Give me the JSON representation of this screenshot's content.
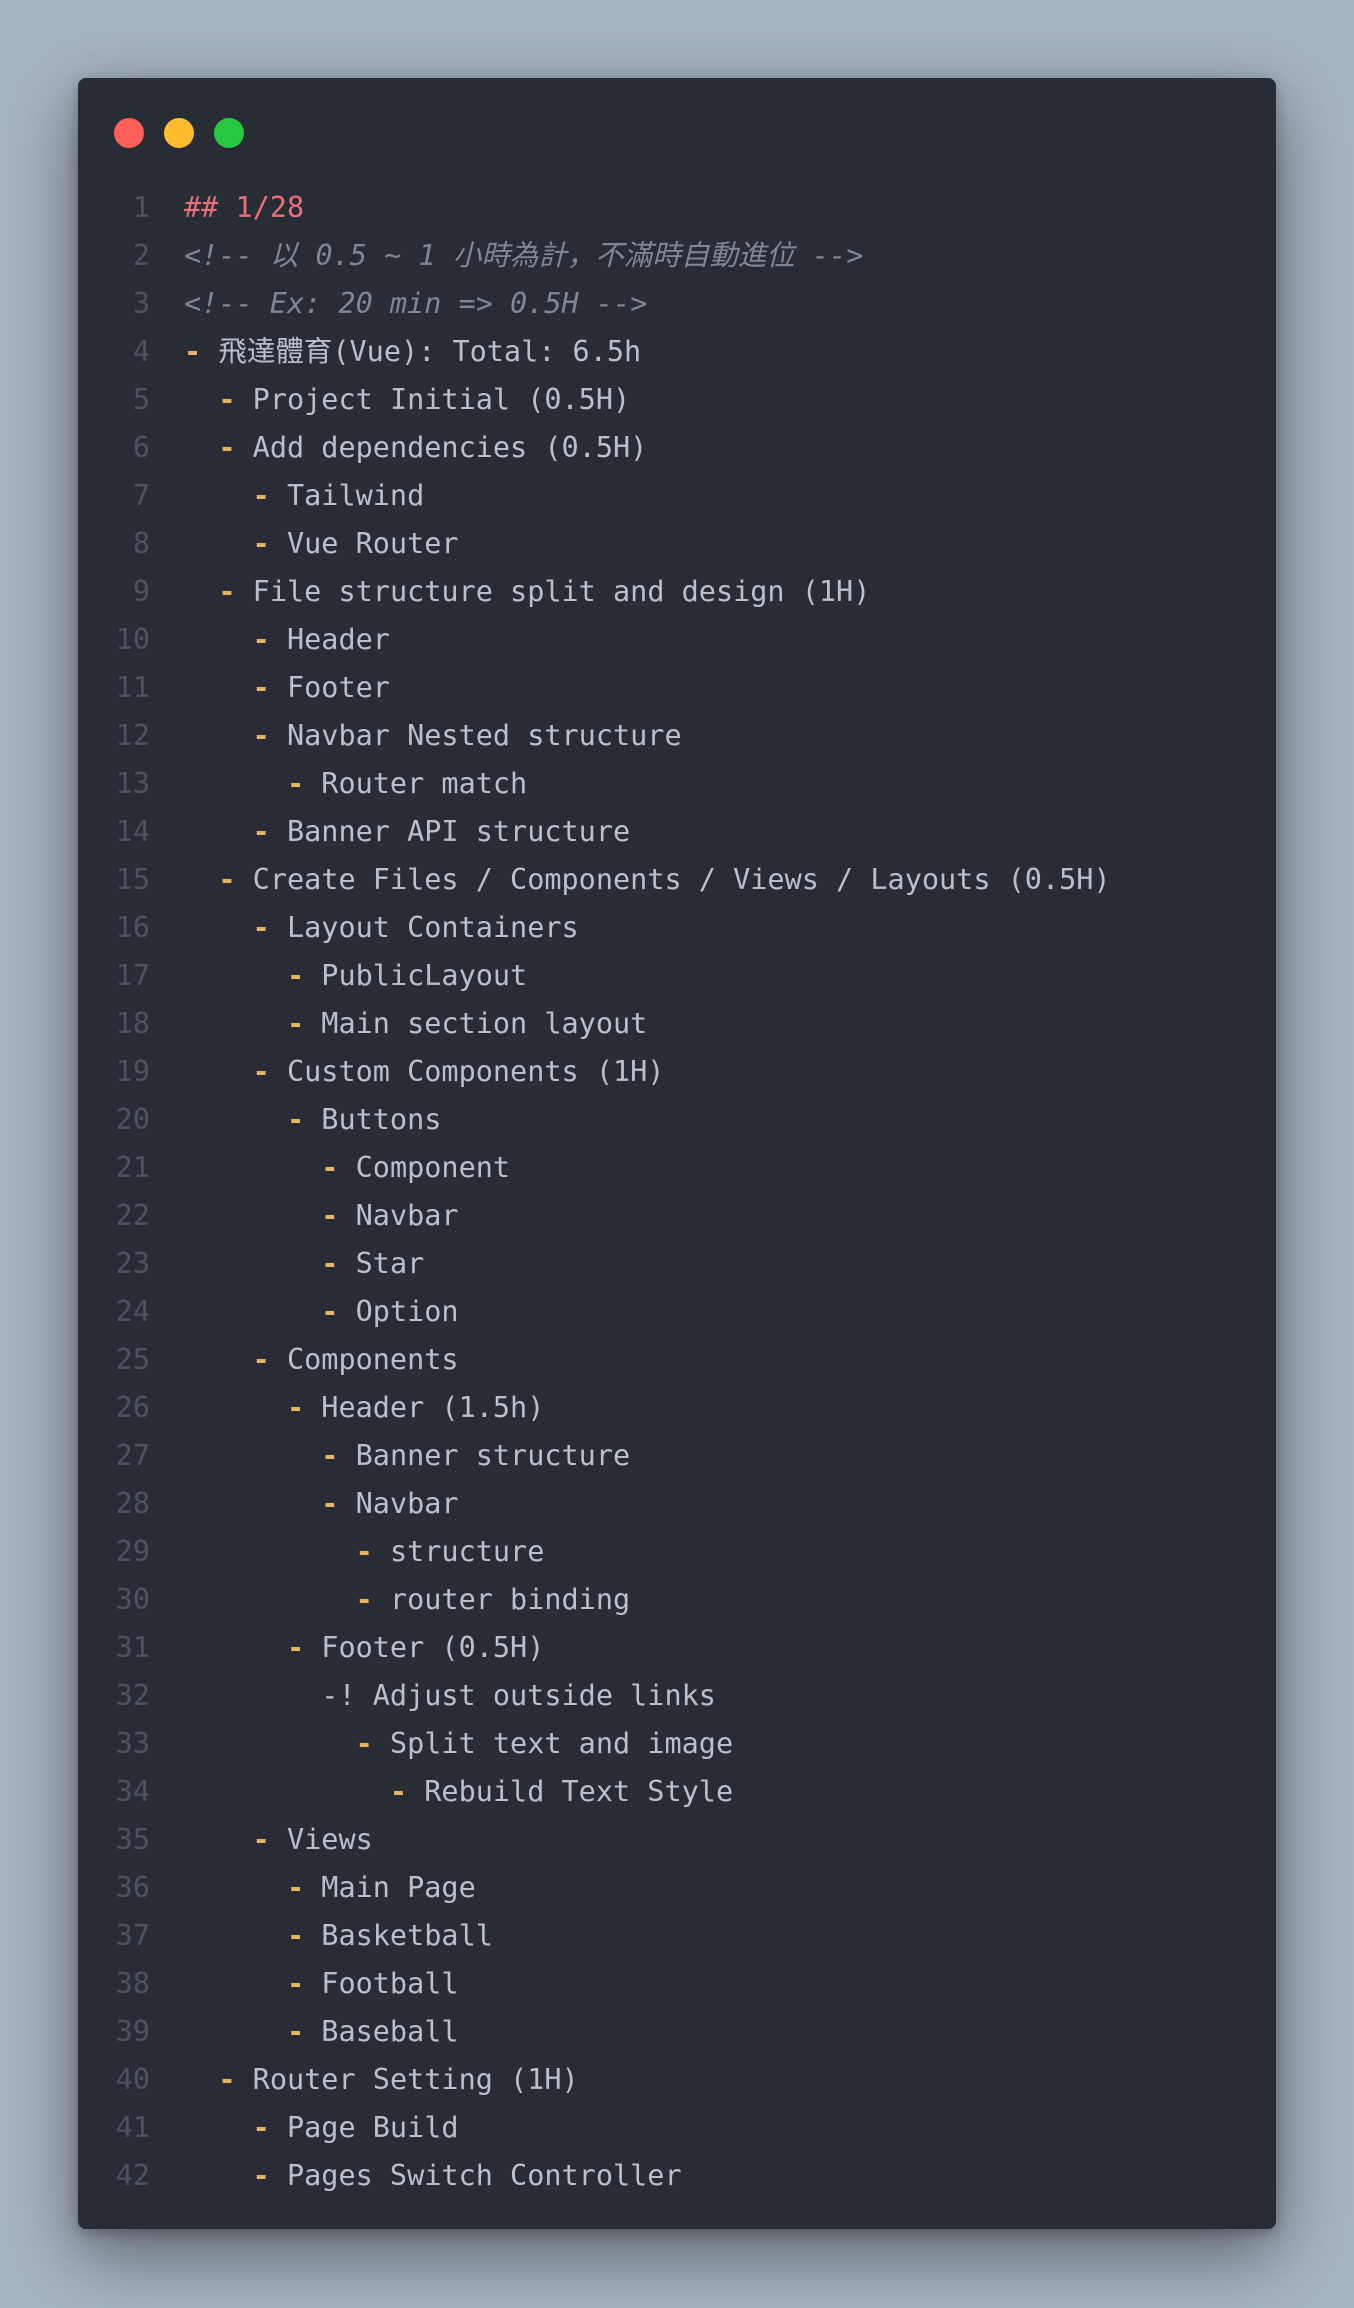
{
  "window": {
    "controls": [
      "close-button",
      "minimize-button",
      "zoom-button"
    ],
    "colors": {
      "background": "#272c35",
      "text": "#b9c0cc",
      "line_number": "#4d5361",
      "list_marker": "#e5b363",
      "heading": "#ea6f78",
      "comment": "#7f8796"
    }
  },
  "lines": [
    {
      "n": "1",
      "indent": 0,
      "type": "heading",
      "marker": "",
      "text": "## 1/28"
    },
    {
      "n": "2",
      "indent": 0,
      "type": "comment",
      "marker": "",
      "text": "<!-- 以 0.5 ~ 1 小時為計，不滿時自動進位 -->"
    },
    {
      "n": "3",
      "indent": 0,
      "type": "comment",
      "marker": "",
      "text": "<!-- Ex: 20 min => 0.5H -->"
    },
    {
      "n": "4",
      "indent": 0,
      "type": "item",
      "marker": "-",
      "text": "飛達體育(Vue): Total: 6.5h"
    },
    {
      "n": "5",
      "indent": 1,
      "type": "item",
      "marker": "-",
      "text": "Project Initial (0.5H)"
    },
    {
      "n": "6",
      "indent": 1,
      "type": "item",
      "marker": "-",
      "text": "Add dependencies (0.5H)"
    },
    {
      "n": "7",
      "indent": 2,
      "type": "item",
      "marker": "-",
      "text": "Tailwind"
    },
    {
      "n": "8",
      "indent": 2,
      "type": "item",
      "marker": "-",
      "text": "Vue Router"
    },
    {
      "n": "9",
      "indent": 1,
      "type": "item",
      "marker": "-",
      "text": "File structure split and design (1H)"
    },
    {
      "n": "10",
      "indent": 2,
      "type": "item",
      "marker": "-",
      "text": "Header"
    },
    {
      "n": "11",
      "indent": 2,
      "type": "item",
      "marker": "-",
      "text": "Footer"
    },
    {
      "n": "12",
      "indent": 2,
      "type": "item",
      "marker": "-",
      "text": "Navbar Nested structure"
    },
    {
      "n": "13",
      "indent": 3,
      "type": "item",
      "marker": "-",
      "text": "Router match"
    },
    {
      "n": "14",
      "indent": 2,
      "type": "item",
      "marker": "-",
      "text": "Banner API structure"
    },
    {
      "n": "15",
      "indent": 1,
      "type": "item",
      "marker": "-",
      "text": "Create Files / Components / Views / Layouts (0.5H)"
    },
    {
      "n": "16",
      "indent": 2,
      "type": "item",
      "marker": "-",
      "text": "Layout Containers"
    },
    {
      "n": "17",
      "indent": 3,
      "type": "item",
      "marker": "-",
      "text": "PublicLayout"
    },
    {
      "n": "18",
      "indent": 3,
      "type": "item",
      "marker": "-",
      "text": "Main section layout"
    },
    {
      "n": "19",
      "indent": 2,
      "type": "item",
      "marker": "-",
      "text": "Custom Components (1H)"
    },
    {
      "n": "20",
      "indent": 3,
      "type": "item",
      "marker": "-",
      "text": "Buttons"
    },
    {
      "n": "21",
      "indent": 4,
      "type": "item",
      "marker": "-",
      "text": "Component"
    },
    {
      "n": "22",
      "indent": 4,
      "type": "item",
      "marker": "-",
      "text": "Navbar"
    },
    {
      "n": "23",
      "indent": 4,
      "type": "item",
      "marker": "-",
      "text": "Star"
    },
    {
      "n": "24",
      "indent": 4,
      "type": "item",
      "marker": "-",
      "text": "Option"
    },
    {
      "n": "25",
      "indent": 2,
      "type": "item",
      "marker": "-",
      "text": "Components"
    },
    {
      "n": "26",
      "indent": 3,
      "type": "item",
      "marker": "-",
      "text": "Header (1.5h)"
    },
    {
      "n": "27",
      "indent": 4,
      "type": "item",
      "marker": "-",
      "text": "Banner structure"
    },
    {
      "n": "28",
      "indent": 4,
      "type": "item",
      "marker": "-",
      "text": "Navbar"
    },
    {
      "n": "29",
      "indent": 5,
      "type": "item",
      "marker": "-",
      "text": "structure"
    },
    {
      "n": "30",
      "indent": 5,
      "type": "item",
      "marker": "-",
      "text": "router binding"
    },
    {
      "n": "31",
      "indent": 3,
      "type": "item",
      "marker": "-",
      "text": "Footer (0.5H)"
    },
    {
      "n": "32",
      "indent": 4,
      "type": "plain",
      "marker": "",
      "text": "-! Adjust outside links"
    },
    {
      "n": "33",
      "indent": 5,
      "type": "item",
      "marker": "-",
      "text": "Split text and image"
    },
    {
      "n": "34",
      "indent": 6,
      "type": "item",
      "marker": "-",
      "text": "Rebuild Text Style"
    },
    {
      "n": "35",
      "indent": 2,
      "type": "item",
      "marker": "-",
      "text": "Views"
    },
    {
      "n": "36",
      "indent": 3,
      "type": "item",
      "marker": "-",
      "text": "Main Page"
    },
    {
      "n": "37",
      "indent": 3,
      "type": "item",
      "marker": "-",
      "text": "Basketball"
    },
    {
      "n": "38",
      "indent": 3,
      "type": "item",
      "marker": "-",
      "text": "Football"
    },
    {
      "n": "39",
      "indent": 3,
      "type": "item",
      "marker": "-",
      "text": "Baseball"
    },
    {
      "n": "40",
      "indent": 1,
      "type": "item",
      "marker": "-",
      "text": "Router Setting (1H)"
    },
    {
      "n": "41",
      "indent": 2,
      "type": "item",
      "marker": "-",
      "text": "Page Build"
    },
    {
      "n": "42",
      "indent": 2,
      "type": "item",
      "marker": "-",
      "text": "Pages Switch Controller"
    }
  ]
}
